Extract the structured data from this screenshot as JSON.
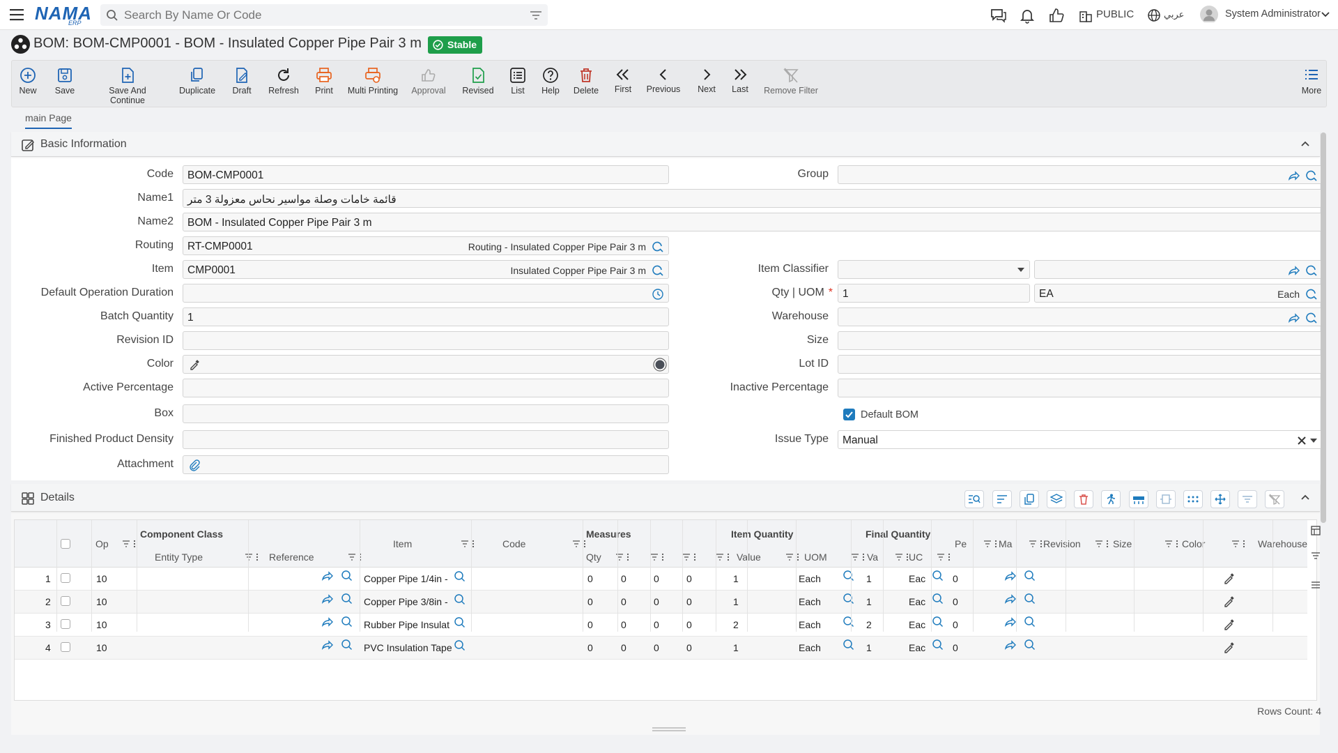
{
  "topbar": {
    "logo": "NAMA",
    "logo_sub": "ERP",
    "search_placeholder": "Search By Name Or Code",
    "public_label": "PUBLIC",
    "lang_label": "عربي",
    "user_name": "System Administrator"
  },
  "title": {
    "text": "BOM: BOM-CMP0001 - BOM - Insulated Copper Pipe Pair 3 m",
    "status": "Stable"
  },
  "toolbar": [
    "New",
    "Save",
    "Save And Continue",
    "Duplicate",
    "Draft",
    "Refresh",
    "Print",
    "Multi Printing",
    "Approval",
    "Revised",
    "List",
    "Help",
    "Delete",
    "First",
    "Previous",
    "Next",
    "Last",
    "Remove Filter",
    "More"
  ],
  "tabs": [
    "main Page"
  ],
  "basic": {
    "section_title": "Basic Information",
    "labels": {
      "code": "Code",
      "name1": "Name1",
      "name2": "Name2",
      "routing": "Routing",
      "item": "Item",
      "default_op_duration": "Default Operation Duration",
      "batch_qty": "Batch Quantity",
      "revision_id": "Revision ID",
      "color": "Color",
      "active_pct": "Active Percentage",
      "box": "Box",
      "finished_density": "Finished Product Density",
      "attachment": "Attachment",
      "group": "Group",
      "item_classifier": "Item Classifier",
      "qty_uom": "Qty | UOM",
      "warehouse": "Warehouse",
      "size": "Size",
      "lot_id": "Lot ID",
      "inactive_pct": "Inactive Percentage",
      "default_bom": "Default BOM",
      "issue_type": "Issue Type"
    },
    "values": {
      "code": "BOM-CMP0001",
      "name1": "قائمة خامات وصلة مواسير نحاس معزولة 3 متر",
      "name2": "BOM - Insulated Copper Pipe Pair 3 m",
      "routing": "RT-CMP0001",
      "routing_name": "Routing - Insulated Copper Pipe Pair 3 m",
      "item": "CMP0001",
      "item_name": "Insulated Copper Pipe Pair 3 m",
      "batch_qty": "1",
      "qty": "1",
      "uom_code": "EA",
      "uom_name": "Each",
      "issue_type": "Manual",
      "default_bom_checked": true
    }
  },
  "details": {
    "section_title": "Details",
    "group_headers": [
      "Component Class",
      "Measures",
      "Item Quantity",
      "Final Quantity"
    ],
    "headers": {
      "op": "Op",
      "entity_type": "Entity Type",
      "reference": "Reference",
      "item": "Item",
      "code": "Code",
      "qty": "Qty",
      "value": "Value",
      "uom": "UOM",
      "fvalue": "Va",
      "fuom": "UC",
      "per": "Pe",
      "ma": "Ma",
      "revision": "Revision",
      "size": "Size",
      "color": "Color",
      "warehouse": "Warehouse"
    },
    "rows": [
      {
        "n": "1",
        "op": "10",
        "item": "Copper Pipe 1/4in -",
        "m1": "0",
        "m2": "0",
        "m3": "0",
        "m4": "0",
        "value": "1",
        "uom": "Each",
        "fvalue": "1",
        "fuom": "Eac",
        "per": "0"
      },
      {
        "n": "2",
        "op": "10",
        "item": "Copper Pipe 3/8in -",
        "m1": "0",
        "m2": "0",
        "m3": "0",
        "m4": "0",
        "value": "1",
        "uom": "Each",
        "fvalue": "1",
        "fuom": "Eac",
        "per": "0"
      },
      {
        "n": "3",
        "op": "10",
        "item": "Rubber Pipe Insulat",
        "m1": "0",
        "m2": "0",
        "m3": "0",
        "m4": "0",
        "value": "2",
        "uom": "Each",
        "fvalue": "2",
        "fuom": "Eac",
        "per": "0"
      },
      {
        "n": "4",
        "op": "10",
        "item": "PVC Insulation Tape",
        "m1": "0",
        "m2": "0",
        "m3": "0",
        "m4": "0",
        "value": "1",
        "uom": "Each",
        "fvalue": "1",
        "fuom": "Eac",
        "per": "0"
      }
    ],
    "rows_count": "Rows Count: 4"
  },
  "colors": {
    "brand": "#1e64b4",
    "accent": "#1e7bbd",
    "stable": "#1e9e4a",
    "delete": "#c0392b",
    "print": "#e8621d"
  }
}
